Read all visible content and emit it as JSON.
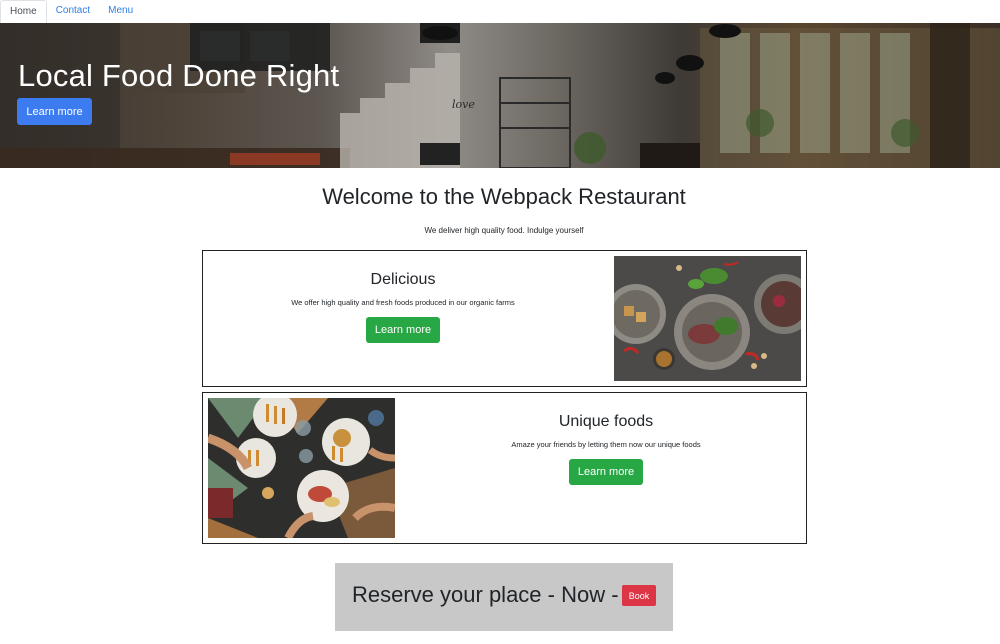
{
  "nav": {
    "tabs": [
      {
        "label": "Home",
        "active": true
      },
      {
        "label": "Contact",
        "active": false
      },
      {
        "label": "Menu",
        "active": false
      }
    ]
  },
  "hero": {
    "title": "Local Food Done Right",
    "button_label": "Learn more",
    "sign_text": "love"
  },
  "welcome": {
    "title": "Welcome to the Webpack Restaurant",
    "subtitle": "We deliver high quality food. Indulge yourself"
  },
  "cards": [
    {
      "title": "Delicious",
      "description": "We offer high quality and fresh foods produced in our organic farms",
      "button_label": "Learn more"
    },
    {
      "title": "Unique foods",
      "description": "Amaze your friends by letting them now our unique foods",
      "button_label": "Learn more"
    }
  ],
  "reserve": {
    "text": "Reserve your place - Now -",
    "button_label": "Book"
  },
  "colors": {
    "primary": "#3d7cf0",
    "success": "#28a745",
    "danger": "#dc3545",
    "link": "#2f7ee6",
    "banner_bg": "#c8c8c8"
  }
}
